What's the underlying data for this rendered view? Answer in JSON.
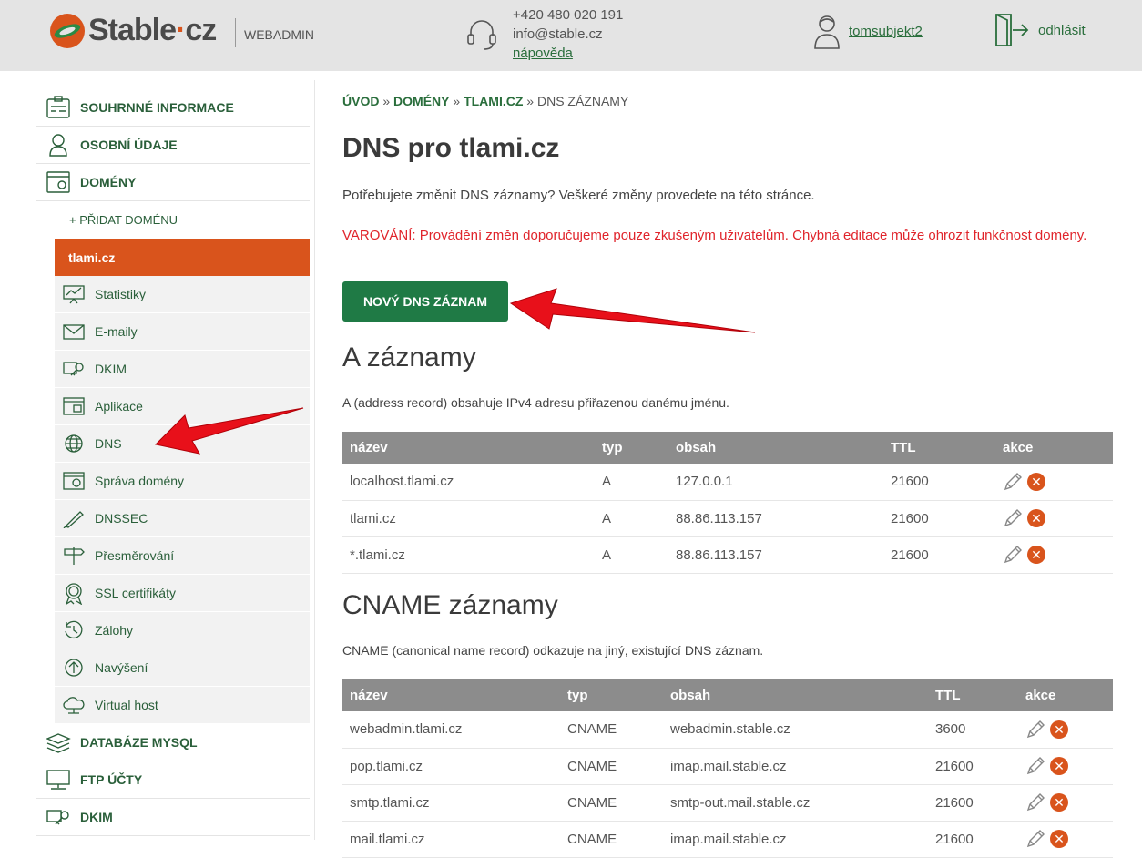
{
  "header": {
    "brand_name": "Stable",
    "brand_dot": "·",
    "brand_tld": "cz",
    "section": "WEBADMIN",
    "phone": "+420 480 020 191",
    "email": "info@stable.cz",
    "help": "nápověda",
    "username": "tomsubjekt2",
    "logout": "odhlásit"
  },
  "sidebar": {
    "items_top": [
      {
        "label": "SOUHRNNÉ INFORMACE",
        "icon": "summary-icon"
      },
      {
        "label": "OSOBNÍ ÚDAJE",
        "icon": "person-icon"
      },
      {
        "label": "DOMÉNY",
        "icon": "domain-icon"
      }
    ],
    "add_domain": "+ PŘIDAT DOMÉNU",
    "active_domain": "tlami.cz",
    "domain_items": [
      {
        "label": "Statistiky",
        "icon": "statistics-icon"
      },
      {
        "label": "E-maily",
        "icon": "email-icon"
      },
      {
        "label": "DKIM",
        "icon": "key-icon"
      },
      {
        "label": "Aplikace",
        "icon": "application-icon"
      },
      {
        "label": "DNS",
        "icon": "globe-icon"
      },
      {
        "label": "Správa domény",
        "icon": "domain-settings-icon"
      },
      {
        "label": "DNSSEC",
        "icon": "dnssec-icon"
      },
      {
        "label": "Přesměrování",
        "icon": "signpost-icon"
      },
      {
        "label": "SSL certifikáty",
        "icon": "ssl-badge-icon"
      },
      {
        "label": "Zálohy",
        "icon": "backup-icon"
      },
      {
        "label": "Navýšení",
        "icon": "upgrade-icon"
      },
      {
        "label": "Virtual host",
        "icon": "cloud-icon"
      }
    ],
    "items_bottom": [
      {
        "label": "DATABÁZE MYSQL",
        "icon": "database-icon"
      },
      {
        "label": "FTP ÚČTY",
        "icon": "ftp-icon"
      },
      {
        "label": "DKIM",
        "icon": "key-icon"
      }
    ]
  },
  "breadcrumb": {
    "home": "ÚVOD",
    "domains": "DOMÉNY",
    "domain": "TLAMI.CZ",
    "current": "DNS ZÁZNAMY",
    "sep": "»"
  },
  "page": {
    "title": "DNS pro tlami.cz",
    "intro": "Potřebujete změnit DNS záznamy? Veškeré změny provedete na této stránce.",
    "warning": "VAROVÁNÍ: Provádění změn doporučujeme pouze zkušeným uživatelům. Chybná editace může ohrozit funkčnost domény.",
    "new_record_button": "NOVÝ DNS ZÁZNAM"
  },
  "a_records": {
    "title": "A záznamy",
    "description": "A (address record) obsahuje IPv4 adresu přiřazenou danému jménu.",
    "columns": [
      "název",
      "typ",
      "obsah",
      "TTL",
      "akce"
    ],
    "rows": [
      [
        "localhost.tlami.cz",
        "A",
        "127.0.0.1",
        "21600"
      ],
      [
        "tlami.cz",
        "A",
        "88.86.113.157",
        "21600"
      ],
      [
        "*.tlami.cz",
        "A",
        "88.86.113.157",
        "21600"
      ]
    ]
  },
  "cname_records": {
    "title": "CNAME záznamy",
    "description": "CNAME (canonical name record) odkazuje na jiný, existující DNS záznam.",
    "columns": [
      "název",
      "typ",
      "obsah",
      "TTL",
      "akce"
    ],
    "rows": [
      [
        "webadmin.tlami.cz",
        "CNAME",
        "webadmin.stable.cz",
        "3600"
      ],
      [
        "pop.tlami.cz",
        "CNAME",
        "imap.mail.stable.cz",
        "21600"
      ],
      [
        "smtp.tlami.cz",
        "CNAME",
        "smtp-out.mail.stable.cz",
        "21600"
      ],
      [
        "mail.tlami.cz",
        "CNAME",
        "imap.mail.stable.cz",
        "21600"
      ]
    ]
  },
  "colors": {
    "brand_orange": "#d9541c",
    "brand_green": "#1f7a45",
    "warning_red": "#e0242b",
    "arrow_red": "#e8101a"
  }
}
